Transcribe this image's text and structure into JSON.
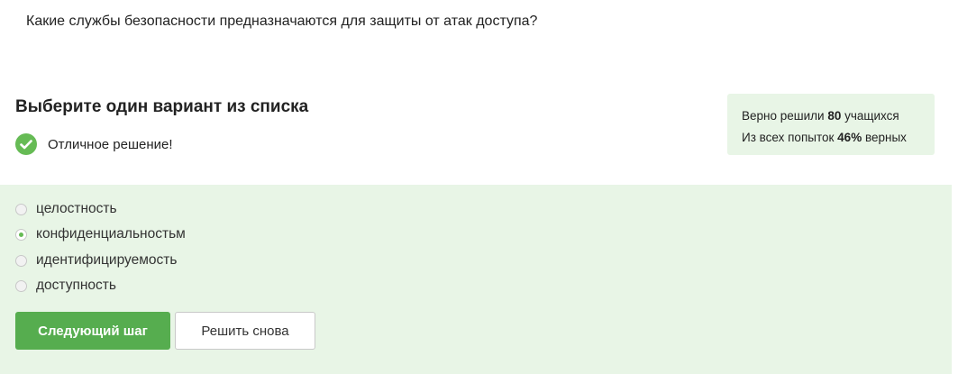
{
  "question": "Какие службы безопасности предназначаются для защиты от атак доступа?",
  "heading": "Выберите один вариант из списка",
  "feedback": "Отличное решение!",
  "stats": {
    "line1_prefix": "Верно решили",
    "line1_count": "80",
    "line1_suffix": "учащихся",
    "line2_prefix": "Из всех попыток",
    "line2_percent": "46%",
    "line2_suffix": "верных"
  },
  "options": [
    {
      "label": "целостность",
      "selected": false
    },
    {
      "label": "конфиденциальностьм",
      "selected": true
    },
    {
      "label": "идентифицируемость",
      "selected": false
    },
    {
      "label": "доступность",
      "selected": false
    }
  ],
  "buttons": {
    "next": "Следующий шаг",
    "retry": "Решить снова"
  },
  "colors": {
    "accent": "#56ad4f",
    "answer_bg": "#e8f5e6"
  }
}
